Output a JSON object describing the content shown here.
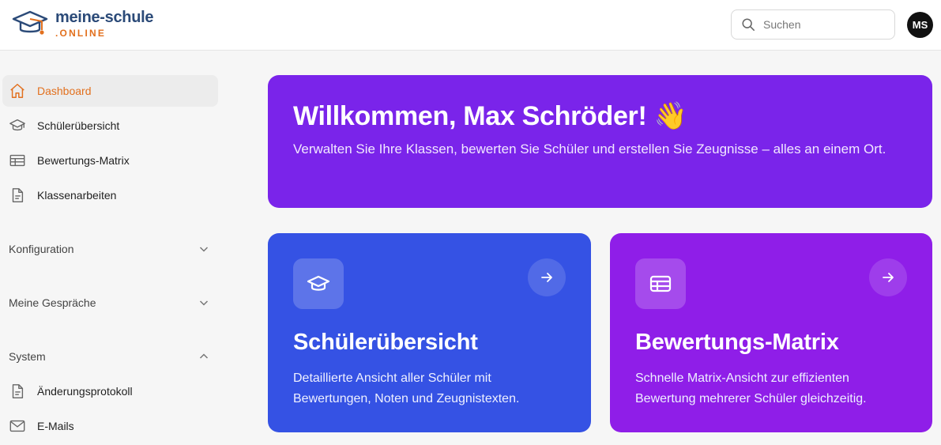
{
  "brand": {
    "name": "meine-schule",
    "suffix": ".ONLINE"
  },
  "search": {
    "placeholder": "Suchen"
  },
  "user": {
    "initials": "MS"
  },
  "sidebar": {
    "items": [
      {
        "label": "Dashboard",
        "icon": "home-icon",
        "active": true
      },
      {
        "label": "Schülerübersicht",
        "icon": "graduation-cap-icon"
      },
      {
        "label": "Bewertungs-Matrix",
        "icon": "table-icon"
      },
      {
        "label": "Klassenarbeiten",
        "icon": "document-icon"
      }
    ],
    "sections": [
      {
        "label": "Konfiguration",
        "state": "collapsed"
      },
      {
        "label": "Meine Gespräche",
        "state": "collapsed"
      },
      {
        "label": "System",
        "state": "expanded"
      }
    ],
    "system_items": [
      {
        "label": "Änderungsprotokoll",
        "icon": "document-icon"
      },
      {
        "label": "E-Mails",
        "icon": "mail-icon"
      }
    ]
  },
  "hero": {
    "title": "Willkommen, Max Schröder! 👋",
    "subtitle": "Verwalten Sie Ihre Klassen, bewerten Sie Schüler und erstellen Sie Zeugnisse – alles an einem Ort."
  },
  "cards": [
    {
      "title": "Schülerübersicht",
      "description": "Detaillierte Ansicht aller Schüler mit Bewertungen, Noten und Zeugnistexten.",
      "icon": "graduation-cap-icon",
      "color": "#3552e4"
    },
    {
      "title": "Bewertungs-Matrix",
      "description": "Schnelle Matrix-Ansicht zur effizienten Bewertung mehrerer Schüler gleichzeitig.",
      "icon": "table-icon",
      "color": "#8f1ee8"
    }
  ],
  "colors": {
    "accent": "#e2701e",
    "hero": "#7a24ea",
    "brand_blue": "#2b4a78"
  }
}
